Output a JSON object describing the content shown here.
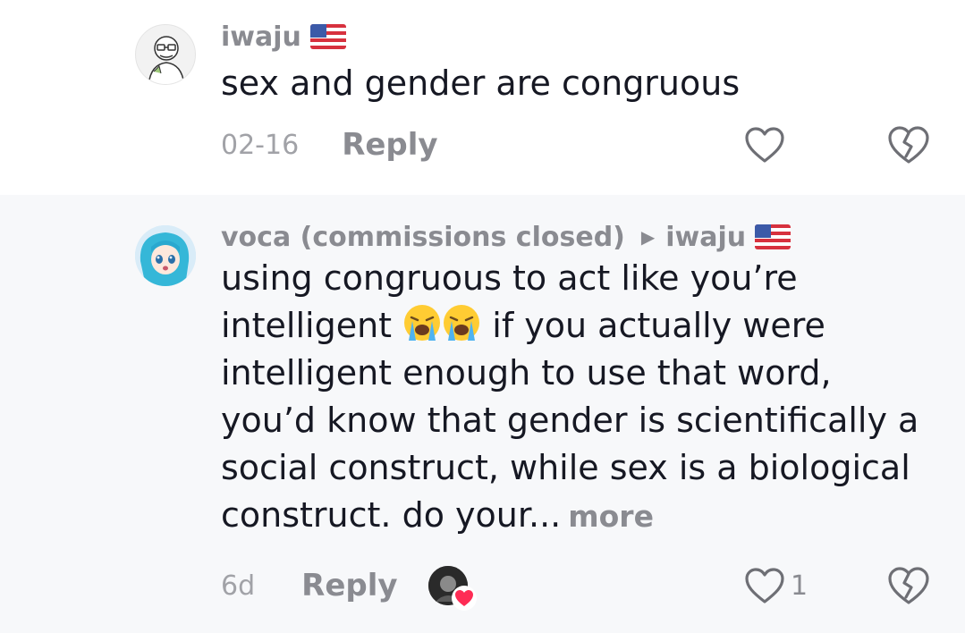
{
  "comments": [
    {
      "avatar_icon": "cartoon-man-avatar",
      "username": "iwaju",
      "flag_icon": "us-flag-icon",
      "text": "sex and gender are congruous",
      "date": "02-16",
      "reply_label": "Reply",
      "like_count": ""
    },
    {
      "avatar_icon": "anime-character-avatar",
      "username": "voca (commissions closed)",
      "reply_to_icon": "play-arrow-icon",
      "reply_to": "iwaju",
      "flag_icon": "us-flag-icon",
      "text_part1": "using congruous to act like you’re intelligent",
      "emoji_icon": "loudly-crying-face-emoji",
      "text_part2": "if you actually were intelligent enough to use that word, you’d know that gender is scientifically a social construct, while sex is a biological construct. do your...",
      "more_label": "more",
      "date": "6d",
      "reply_label": "Reply",
      "creator_liked_icon": "creator-liked-avatar",
      "like_count": "1"
    }
  ],
  "colors": {
    "text_primary": "#161823",
    "text_secondary": "#8a8b91",
    "highlight_bg": "#f7f8fa",
    "heart_red": "#fe2c55"
  }
}
